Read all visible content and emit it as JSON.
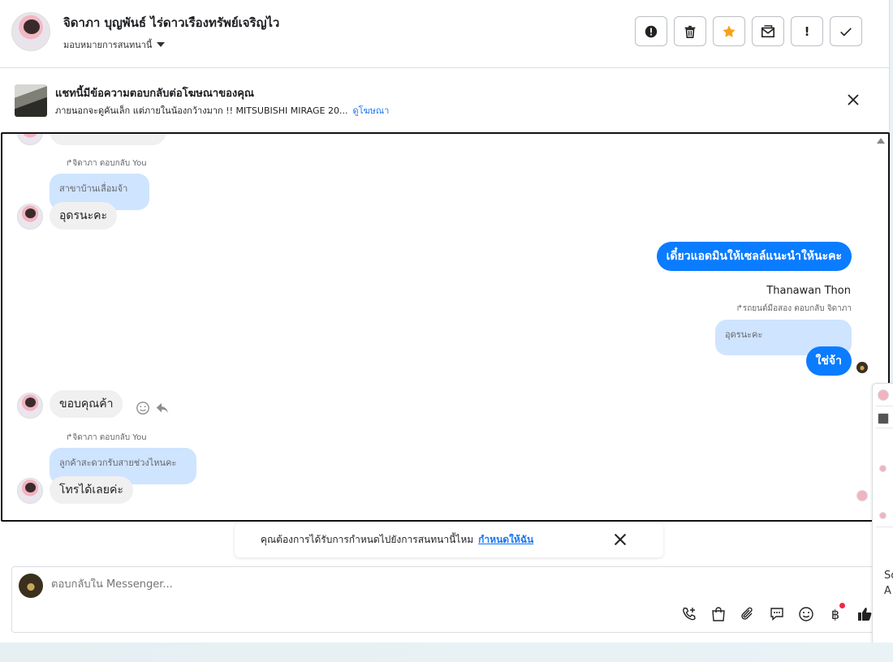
{
  "header": {
    "contact_name": "จิดาภา บุญพันธ์ ไร่ดาวเรืองทรัพย์เจริญไว",
    "assign_label": "มอบหมายการสนทนานี้",
    "actions": [
      "report-icon",
      "trash-icon",
      "star-icon",
      "mark-unread-icon",
      "important-icon",
      "check-icon"
    ],
    "action_labels": [
      "!",
      "",
      "",
      "",
      "!",
      ""
    ],
    "star_color": "#f7a21b"
  },
  "ad_banner": {
    "title": "แชทนี้มีข้อความตอบกลับต่อโฆษณาของคุณ",
    "description": "ภายนอกจะดูคันเล็ก แต่ภายในน้องกว้างมาก !! MITSUBISHI MIRAGE 20...",
    "link": "ดูโฆษณา"
  },
  "messages": {
    "reply1_meta": "จิดาภา ตอบกลับ You",
    "reply1_quote": "สาขาบ้านเลื่อมจ้า",
    "reply1_text": "อุดรนะคะ",
    "out1_text": "เดี๋ยวแอดมินให้เซลล์แนะนำให้นะคะ",
    "out2_sender": "Thanawan Thon",
    "out2_meta": "รถยนต์มือสอง ตอบกลับ จิดาภา",
    "out2_quote": "อุดรนะคะ",
    "out2_text": "ใช่จ้า",
    "in2_text": "ขอบคุณค้า",
    "reply2_meta": "จิดาภา ตอบกลับ You",
    "reply2_quote": "ลูกค้าสะดวกรับสายช่วงไหนคะ",
    "reply2_text": "โทรได้เลยค่ะ",
    "accent_color": "#0a7cff"
  },
  "suggestion": {
    "text": "คุณต้องการได้รับการกำหนดไปยังการสนทนานี้ไหม",
    "link": "กำหนดให้ฉัน"
  },
  "composer": {
    "placeholder": "ตอบกลับใน Messenger...",
    "tools": [
      "call-add-icon",
      "shop-bag-icon",
      "attach-icon",
      "chat-bubble-icon",
      "emoji-icon",
      "baht-icon",
      "thumbs-up-icon"
    ],
    "baht_symbol": "฿"
  },
  "side_peek": {
    "text1": "Sc",
    "text2": "A"
  }
}
